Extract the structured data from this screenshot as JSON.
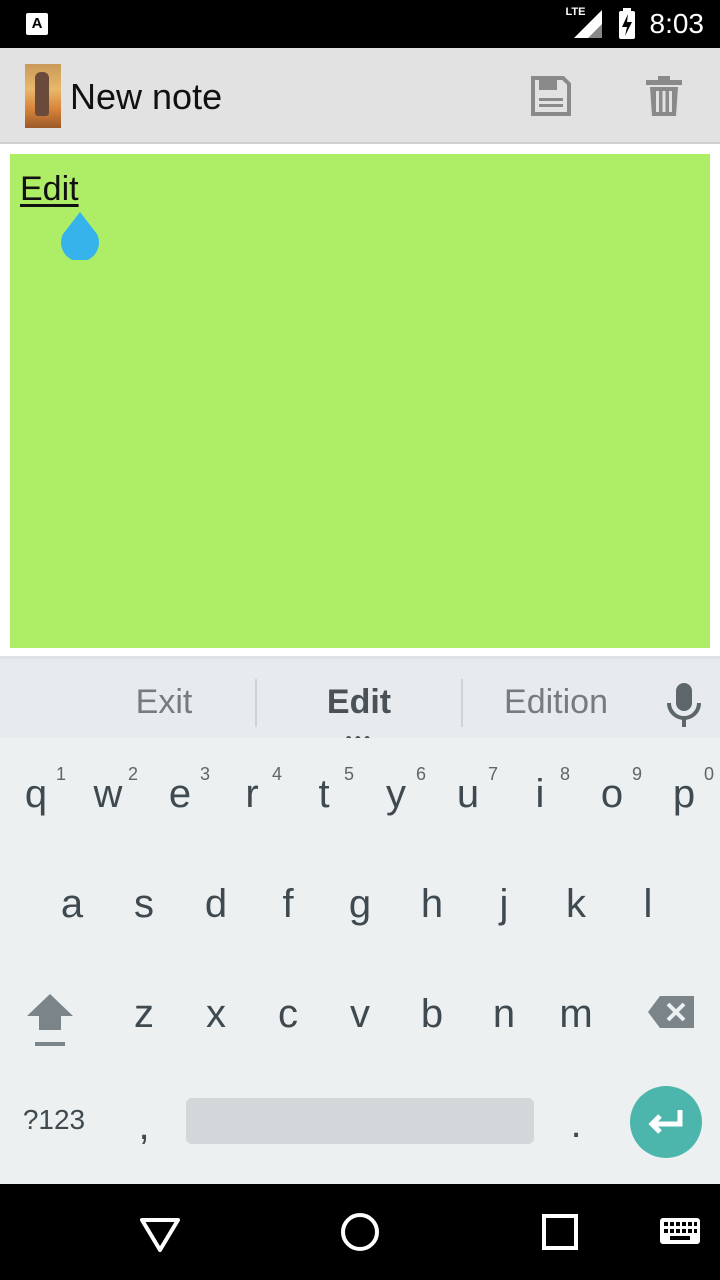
{
  "status_bar": {
    "notification_icon": "A",
    "network_label": "LTE",
    "time": "8:03",
    "icons": [
      "signal-icon",
      "battery-charging-icon"
    ]
  },
  "app_bar": {
    "title": "New note",
    "actions": [
      "save-icon",
      "delete-icon"
    ]
  },
  "note": {
    "text": "Edit",
    "background_color": "#aeee67"
  },
  "suggestions": [
    "Exit",
    "Edit",
    "Edition"
  ],
  "keyboard": {
    "row1": [
      {
        "key": "q",
        "hint": "1"
      },
      {
        "key": "w",
        "hint": "2"
      },
      {
        "key": "e",
        "hint": "3"
      },
      {
        "key": "r",
        "hint": "4"
      },
      {
        "key": "t",
        "hint": "5"
      },
      {
        "key": "y",
        "hint": "6"
      },
      {
        "key": "u",
        "hint": "7"
      },
      {
        "key": "i",
        "hint": "8"
      },
      {
        "key": "o",
        "hint": "9"
      },
      {
        "key": "p",
        "hint": "0"
      }
    ],
    "row2": [
      "a",
      "s",
      "d",
      "f",
      "g",
      "h",
      "j",
      "k",
      "l"
    ],
    "row3": [
      "z",
      "x",
      "c",
      "v",
      "b",
      "n",
      "m"
    ],
    "symbols_label": "?123",
    "comma": ",",
    "period": ".",
    "accent_color": "#4db6ac"
  },
  "nav_bar": [
    "back-icon",
    "home-icon",
    "recents-icon",
    "keyboard-switch-icon"
  ]
}
